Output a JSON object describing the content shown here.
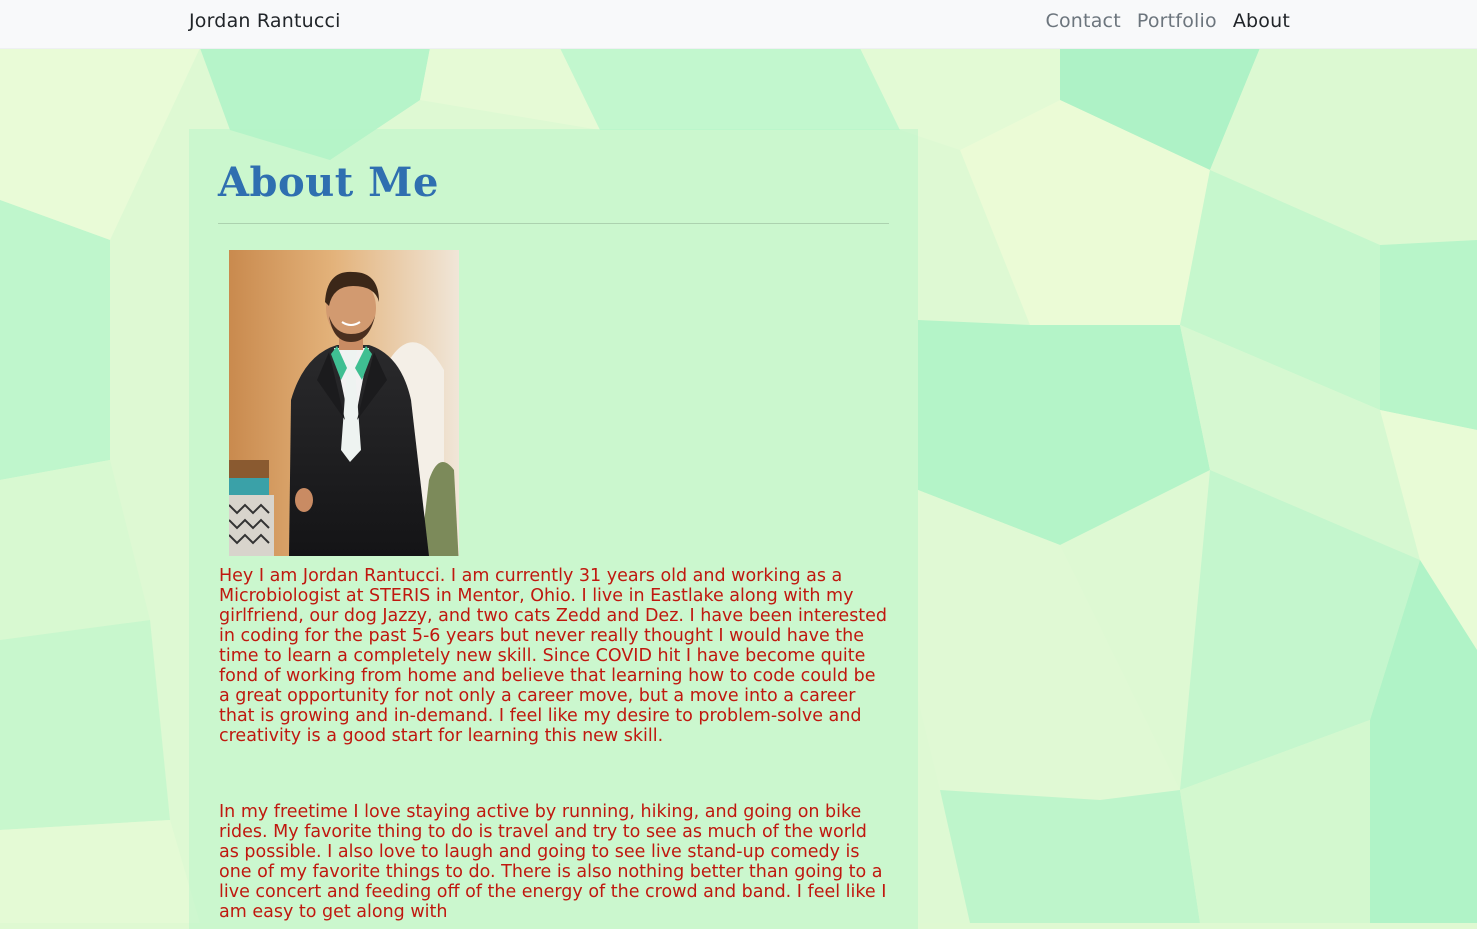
{
  "navbar": {
    "brand": "Jordan Rantucci",
    "links": [
      {
        "label": "Contact",
        "active": false
      },
      {
        "label": "Portfolio",
        "active": false
      },
      {
        "label": "About",
        "active": true
      }
    ]
  },
  "about": {
    "title": "About Me",
    "paragraphs": [
      "Hey I am Jordan Rantucci. I am currently 31 years old and working as a Microbiologist at STERIS in Mentor, Ohio. I live in Eastlake along with my girlfriend, our dog Jazzy, and two cats Zedd and Dez. I have been interested in coding for the past 5-6 years but never really thought I would have the time to learn a completely new skill. Since COVID hit I have become quite fond of working from home and believe that learning how to code could be a great opportunity for not only a career move, but a move into a career that is growing and in-demand. I feel like my desire to problem-solve and creativity is a good start for learning this new skill.",
      "In my freetime I love staying active by running, hiking, and going on bike rides. My favorite thing to do is travel and try to see as much of the world as possible. I also love to laugh and going to see live stand-up comedy is one of my favorite things to do. There is also nothing better than going to a live concert and feeding off of the energy of the crowd and band. I feel like I am easy to get along with"
    ]
  },
  "colors": {
    "background_light": "#e6fad6",
    "background_mid": "#c8f7cc",
    "background_deep": "#aef2c6",
    "title": "#2f6fb0",
    "body_text": "#c0180f",
    "navbar_bg": "#f8f9fa",
    "nav_link": "#6c757d",
    "nav_link_active": "#212529"
  }
}
